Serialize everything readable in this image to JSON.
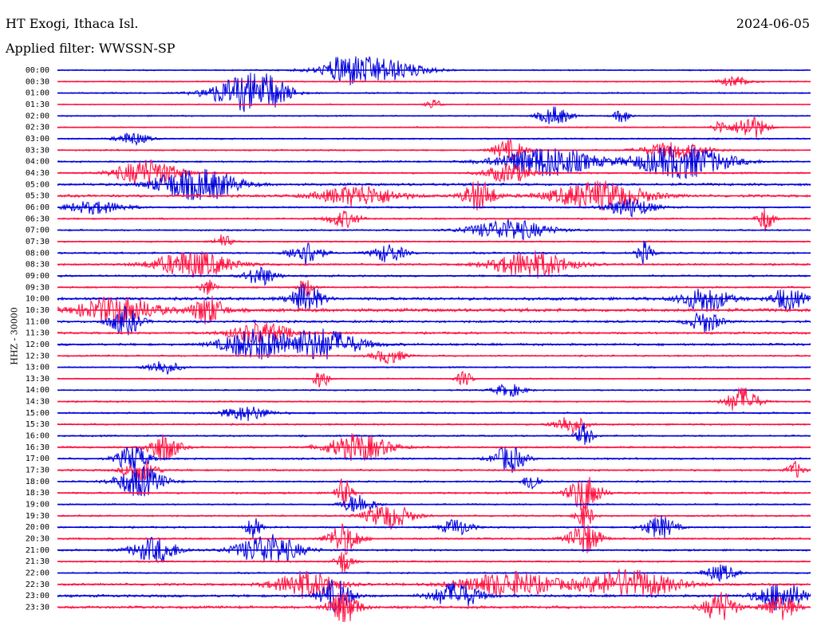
{
  "header": {
    "station": "HT Exogi, Ithaca Isl.",
    "date": "2024-06-05",
    "filter": "Applied filter: WWSSN-SP"
  },
  "chart_data": {
    "type": "line",
    "title": "HT Exogi, Ithaca Isl.",
    "ylabel": "HHZ - 30000",
    "xlabel": "",
    "grid": false,
    "trace_colors": [
      "#0000dd",
      "#ff1040"
    ],
    "row_labels": [
      "00:00",
      "00:30",
      "01:00",
      "01:30",
      "02:00",
      "02:30",
      "03:00",
      "03:30",
      "04:00",
      "04:30",
      "05:00",
      "05:30",
      "06:00",
      "06:30",
      "07:00",
      "07:30",
      "08:00",
      "08:30",
      "09:00",
      "09:30",
      "10:00",
      "10:30",
      "11:00",
      "11:30",
      "12:00",
      "12:30",
      "13:00",
      "13:30",
      "14:00",
      "14:30",
      "15:00",
      "15:30",
      "16:00",
      "16:30",
      "17:00",
      "17:30",
      "18:00",
      "18:30",
      "19:00",
      "19:30",
      "20:00",
      "20:30",
      "21:00",
      "21:30",
      "22:00",
      "22:30",
      "23:00",
      "23:30"
    ],
    "row_activity": [
      {
        "noise": 0.3,
        "bursts": [
          [
            0.42,
            0.06,
            1.2
          ],
          [
            0.38,
            0.02,
            0.8
          ]
        ]
      },
      {
        "noise": 0.3,
        "bursts": [
          [
            0.9,
            0.02,
            0.5
          ]
        ]
      },
      {
        "noise": 0.35,
        "bursts": [
          [
            0.24,
            0.04,
            1.4
          ],
          [
            0.28,
            0.03,
            1.3
          ]
        ]
      },
      {
        "noise": 0.25,
        "bursts": [
          [
            0.5,
            0.01,
            0.5
          ]
        ]
      },
      {
        "noise": 0.3,
        "bursts": [
          [
            0.66,
            0.02,
            0.9
          ],
          [
            0.75,
            0.01,
            0.7
          ]
        ]
      },
      {
        "noise": 0.3,
        "bursts": [
          [
            0.92,
            0.02,
            1.2
          ],
          [
            0.88,
            0.01,
            0.6
          ]
        ]
      },
      {
        "noise": 0.35,
        "bursts": [
          [
            0.1,
            0.02,
            0.6
          ]
        ]
      },
      {
        "noise": 0.35,
        "bursts": [
          [
            0.6,
            0.02,
            1.0
          ],
          [
            0.82,
            0.04,
            0.8
          ]
        ]
      },
      {
        "noise": 0.4,
        "bursts": [
          [
            0.65,
            0.06,
            1.5
          ],
          [
            0.83,
            0.06,
            1.6
          ]
        ]
      },
      {
        "noise": 0.4,
        "bursts": [
          [
            0.12,
            0.04,
            1.3
          ],
          [
            0.6,
            0.03,
            0.9
          ]
        ]
      },
      {
        "noise": 0.6,
        "bursts": [
          [
            0.2,
            0.04,
            1.4
          ],
          [
            0.15,
            0.03,
            0.8
          ]
        ]
      },
      {
        "noise": 0.6,
        "bursts": [
          [
            0.4,
            0.05,
            1.0
          ],
          [
            0.56,
            0.02,
            1.5
          ],
          [
            0.72,
            0.06,
            1.4
          ]
        ]
      },
      {
        "noise": 0.4,
        "bursts": [
          [
            0.05,
            0.04,
            0.6
          ],
          [
            0.76,
            0.03,
            0.9
          ]
        ]
      },
      {
        "noise": 0.4,
        "bursts": [
          [
            0.38,
            0.02,
            0.8
          ],
          [
            0.94,
            0.01,
            1.2
          ]
        ]
      },
      {
        "noise": 0.4,
        "bursts": [
          [
            0.6,
            0.05,
            1.0
          ]
        ]
      },
      {
        "noise": 0.35,
        "bursts": [
          [
            0.22,
            0.01,
            0.7
          ]
        ]
      },
      {
        "noise": 0.45,
        "bursts": [
          [
            0.33,
            0.02,
            1.2
          ],
          [
            0.78,
            0.01,
            1.1
          ],
          [
            0.44,
            0.02,
            0.9
          ]
        ]
      },
      {
        "noise": 0.45,
        "bursts": [
          [
            0.18,
            0.05,
            1.3
          ],
          [
            0.63,
            0.05,
            1.3
          ]
        ]
      },
      {
        "noise": 0.45,
        "bursts": [
          [
            0.27,
            0.02,
            0.9
          ]
        ]
      },
      {
        "noise": 0.4,
        "bursts": [
          [
            0.2,
            0.01,
            0.8
          ],
          [
            0.33,
            0.01,
            0.9
          ]
        ]
      },
      {
        "noise": 0.7,
        "bursts": [
          [
            0.33,
            0.02,
            1.4
          ],
          [
            0.86,
            0.03,
            1.2
          ],
          [
            0.97,
            0.02,
            1.1
          ]
        ]
      },
      {
        "noise": 0.8,
        "bursts": [
          [
            0.08,
            0.05,
            1.3
          ],
          [
            0.2,
            0.02,
            1.4
          ]
        ]
      },
      {
        "noise": 0.55,
        "bursts": [
          [
            0.09,
            0.02,
            1.3
          ],
          [
            0.86,
            0.02,
            1.0
          ]
        ]
      },
      {
        "noise": 0.5,
        "bursts": [
          [
            0.27,
            0.04,
            1.0
          ]
        ]
      },
      {
        "noise": 0.55,
        "bursts": [
          [
            0.26,
            0.04,
            1.4
          ],
          [
            0.35,
            0.05,
            1.5
          ]
        ]
      },
      {
        "noise": 0.4,
        "bursts": [
          [
            0.44,
            0.02,
            0.7
          ]
        ]
      },
      {
        "noise": 0.35,
        "bursts": [
          [
            0.14,
            0.02,
            0.7
          ]
        ]
      },
      {
        "noise": 0.3,
        "bursts": [
          [
            0.35,
            0.01,
            1.0
          ],
          [
            0.54,
            0.01,
            0.7
          ]
        ]
      },
      {
        "noise": 0.35,
        "bursts": [
          [
            0.6,
            0.02,
            0.6
          ]
        ]
      },
      {
        "noise": 0.35,
        "bursts": [
          [
            0.91,
            0.02,
            1.4
          ]
        ]
      },
      {
        "noise": 0.4,
        "bursts": [
          [
            0.25,
            0.03,
            0.7
          ]
        ]
      },
      {
        "noise": 0.4,
        "bursts": [
          [
            0.68,
            0.02,
            0.9
          ]
        ]
      },
      {
        "noise": 0.4,
        "bursts": [
          [
            0.7,
            0.01,
            1.2
          ]
        ]
      },
      {
        "noise": 0.45,
        "bursts": [
          [
            0.14,
            0.02,
            1.4
          ],
          [
            0.4,
            0.04,
            1.3
          ]
        ]
      },
      {
        "noise": 0.45,
        "bursts": [
          [
            0.1,
            0.02,
            1.3
          ],
          [
            0.6,
            0.02,
            1.3
          ]
        ]
      },
      {
        "noise": 0.45,
        "bursts": [
          [
            0.11,
            0.02,
            1.1
          ],
          [
            0.98,
            0.01,
            0.8
          ]
        ]
      },
      {
        "noise": 0.4,
        "bursts": [
          [
            0.11,
            0.03,
            1.5
          ],
          [
            0.63,
            0.01,
            1.0
          ]
        ]
      },
      {
        "noise": 0.45,
        "bursts": [
          [
            0.7,
            0.02,
            1.8
          ],
          [
            0.38,
            0.01,
            1.4
          ]
        ]
      },
      {
        "noise": 0.35,
        "bursts": [
          [
            0.4,
            0.02,
            1.0
          ]
        ]
      },
      {
        "noise": 0.4,
        "bursts": [
          [
            0.44,
            0.03,
            1.2
          ],
          [
            0.7,
            0.01,
            1.4
          ]
        ]
      },
      {
        "noise": 0.4,
        "bursts": [
          [
            0.26,
            0.01,
            1.0
          ],
          [
            0.53,
            0.02,
            0.8
          ],
          [
            0.8,
            0.02,
            1.1
          ]
        ]
      },
      {
        "noise": 0.45,
        "bursts": [
          [
            0.38,
            0.02,
            1.5
          ],
          [
            0.7,
            0.02,
            1.5
          ]
        ]
      },
      {
        "noise": 0.45,
        "bursts": [
          [
            0.13,
            0.03,
            1.2
          ],
          [
            0.28,
            0.04,
            1.5
          ]
        ]
      },
      {
        "noise": 0.4,
        "bursts": [
          [
            0.38,
            0.01,
            1.2
          ]
        ]
      },
      {
        "noise": 0.35,
        "bursts": [
          [
            0.88,
            0.02,
            0.8
          ]
        ]
      },
      {
        "noise": 0.55,
        "bursts": [
          [
            0.33,
            0.04,
            1.3
          ],
          [
            0.6,
            0.06,
            1.2
          ],
          [
            0.76,
            0.06,
            1.4
          ]
        ]
      },
      {
        "noise": 0.6,
        "bursts": [
          [
            0.37,
            0.02,
            1.6
          ],
          [
            0.53,
            0.03,
            1.3
          ],
          [
            0.96,
            0.03,
            1.4
          ]
        ]
      },
      {
        "noise": 0.6,
        "bursts": [
          [
            0.38,
            0.02,
            1.6
          ],
          [
            0.88,
            0.02,
            1.5
          ],
          [
            0.96,
            0.02,
            1.2
          ]
        ]
      }
    ]
  }
}
